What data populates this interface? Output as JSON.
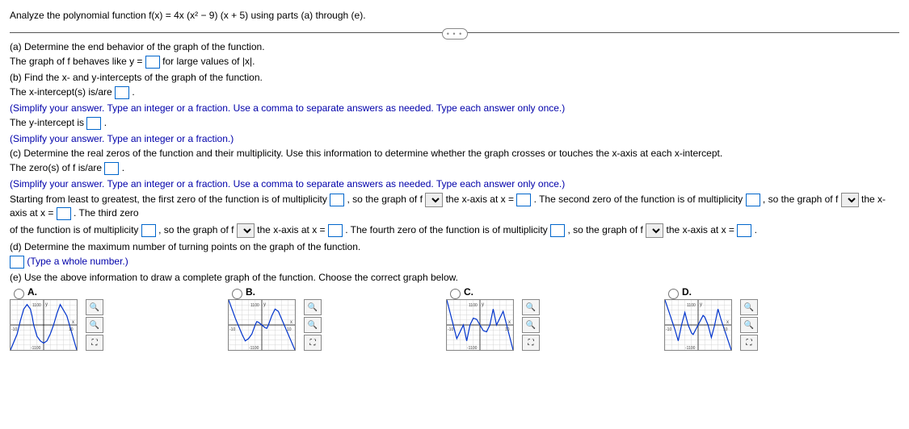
{
  "header": "Analyze the polynomial function f(x) = 4x (x² − 9) (x + 5) using parts (a) through (e).",
  "expander": "• • •",
  "partA": {
    "title": "(a) Determine the end behavior of the graph of the function.",
    "sentence_pre": "The graph of f behaves like y =",
    "sentence_post": " for large values of |x|."
  },
  "partB": {
    "title": "(b) Find the x- and y-intercepts of the graph of the function.",
    "xint_pre": "The x-intercept(s) is/are ",
    "xint_post": ".",
    "xint_instr": "(Simplify your answer. Type an integer or a fraction. Use a comma to separate answers as needed. Type each answer only once.)",
    "yint_pre": "The y-intercept is ",
    "yint_post": ".",
    "yint_instr": "(Simplify your answer. Type an integer or a fraction.)"
  },
  "partC": {
    "title": "(c) Determine the real zeros of the function and their multiplicity. Use this information to determine whether the graph crosses or touches the x-axis at each x-intercept.",
    "zeros_pre": "The zero(s) of f is/are ",
    "zeros_post": ".",
    "zeros_instr": "(Simplify your answer. Type an integer or a fraction. Use a comma to separate answers as needed. Type each answer only once.)",
    "s1a": "Starting from least to greatest, the first zero of the function is of multiplicity ",
    "s1b": ", so the graph of f ",
    "s1c": " the x-axis at x = ",
    "s2a": ". The second zero of the function is of multiplicity ",
    "s2b": ", so the graph of f ",
    "s2c": " the x-axis at x = ",
    "s3a": ". The third zero",
    "s3line2a": "of the function is of multiplicity ",
    "s3b": ", so the graph of f ",
    "s3c": " the x-axis at x = ",
    "s4a": ". The fourth zero of the function is of multiplicity ",
    "s4b": ", so the graph of f ",
    "s4c": " the x-axis at x = ",
    "s4d": "."
  },
  "partD": {
    "title": "(d) Determine the maximum number of turning points on the graph of the function.",
    "post": " (Type a whole number.)"
  },
  "partE": {
    "title": "(e) Use the above information to draw a complete graph of the function. Choose the correct graph below.",
    "choices": [
      "A.",
      "B.",
      "C.",
      "D."
    ],
    "axis_y_top": "1100",
    "axis_y_bot": "-1100",
    "axis_x_neg": "-10",
    "axis_x_pos": "10",
    "axis_xlabel": "x",
    "axis_ylabel": "y"
  },
  "tools": {
    "zoom_in": "🔍",
    "zoom_out": "🔍",
    "expand": "⛶"
  },
  "chart_data": [
    {
      "type": "line",
      "label": "A",
      "xlim": [
        -10,
        10
      ],
      "ylim": [
        -1100,
        1100
      ],
      "x": [
        -10,
        -8,
        -7,
        -6,
        -5,
        -4,
        -3.5,
        -3,
        -2,
        -1,
        0,
        1,
        2,
        3,
        4,
        5,
        7,
        10
      ],
      "y": [
        -1100,
        -400,
        200,
        700,
        900,
        700,
        400,
        0,
        -500,
        -700,
        -800,
        -700,
        -400,
        0,
        500,
        900,
        400,
        -1100
      ]
    },
    {
      "type": "line",
      "label": "B",
      "xlim": [
        -10,
        10
      ],
      "ylim": [
        -1100,
        1100
      ],
      "x": [
        -10,
        -8,
        -6,
        -5,
        -4,
        -3,
        -2,
        -1.5,
        -1,
        0,
        1,
        1.5,
        2,
        3,
        4,
        5,
        10
      ],
      "y": [
        1100,
        300,
        -400,
        -700,
        -600,
        -400,
        0,
        150,
        120,
        0,
        -120,
        -150,
        0,
        400,
        700,
        600,
        -1100
      ]
    },
    {
      "type": "line",
      "label": "C",
      "xlim": [
        -10,
        10
      ],
      "ylim": [
        -1100,
        1100
      ],
      "x": [
        -10,
        -7,
        -5,
        -4,
        -3,
        -2,
        -1,
        0,
        1,
        2,
        3,
        4,
        5,
        7,
        10
      ],
      "y": [
        1100,
        -600,
        0,
        -700,
        0,
        300,
        250,
        0,
        -250,
        -300,
        0,
        700,
        0,
        600,
        -1100
      ]
    },
    {
      "type": "line",
      "label": "D",
      "xlim": [
        -10,
        10
      ],
      "ylim": [
        -1100,
        1100
      ],
      "x": [
        -10,
        -7,
        -6,
        -5,
        -4,
        -3,
        -2,
        -1.5,
        0,
        1.5,
        2,
        3,
        4,
        5,
        6,
        7,
        10
      ],
      "y": [
        1100,
        -200,
        -700,
        0,
        550,
        0,
        -350,
        -420,
        0,
        420,
        350,
        0,
        -550,
        0,
        700,
        200,
        -1100
      ]
    }
  ]
}
